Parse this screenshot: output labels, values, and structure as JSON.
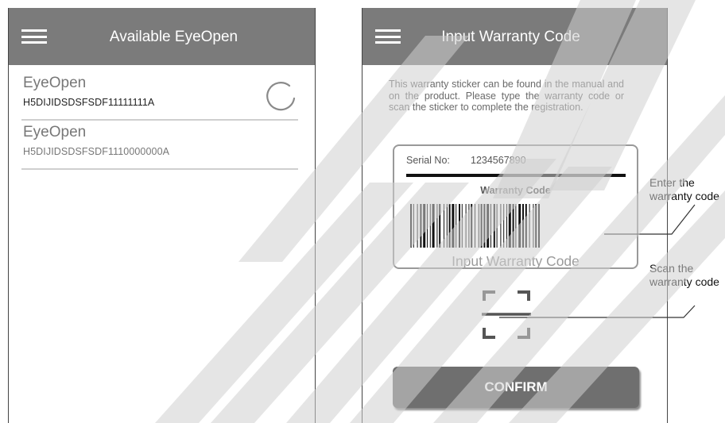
{
  "left_screen": {
    "title": "Available EyeOpen",
    "menu_icon": "hamburger-menu-icon",
    "devices": [
      {
        "name": "EyeOpen",
        "serial": "H5DIJIDSDSFSDF11111111A",
        "status": "connecting"
      },
      {
        "name": "EyeOpen",
        "serial": "H5DIJIDSDSFSDF1110000000A"
      }
    ],
    "spinner_icon": "loading-spinner-icon"
  },
  "right_screen": {
    "title": "Input Warranty Code",
    "menu_icon": "hamburger-menu-icon",
    "instructions": "This warranty sticker can be found in the manual and on the product. Please type the warranty code or scan the sticker to complete the registration.",
    "sticker": {
      "serial_label": "Serial No:",
      "serial_value": "1234567890",
      "caption": "Warranty Code",
      "input_placeholder": "Input Warranty Code"
    },
    "scan_icon": "scan-frame-icon",
    "confirm_label": "CONFIRM"
  },
  "annotations": {
    "enter_code": "Enter the warranty code",
    "scan_code": "Scan the warranty code"
  },
  "colors": {
    "app_bar": "#7b7b7b",
    "confirm_button": "#6f6f6f",
    "watermark": "#d0d0d0"
  }
}
